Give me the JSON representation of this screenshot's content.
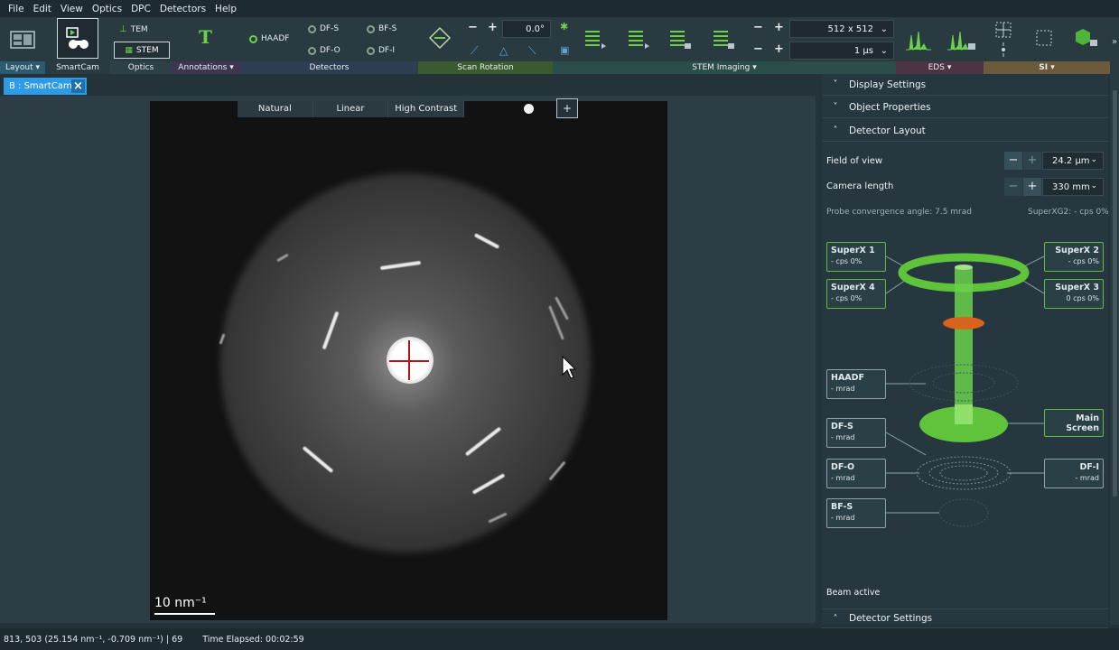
{
  "menu": [
    "File",
    "Edit",
    "View",
    "Optics",
    "DPC",
    "Detectors",
    "Help"
  ],
  "ribbon": {
    "layout_label": "Layout",
    "smartcam_label": "SmartCam",
    "optics_label": "Optics",
    "tem_label": "TEM",
    "stem_label": "STEM",
    "annotations_label": "Annotations",
    "detectors_label": "Detectors",
    "haadf_label": "HAADF",
    "dfs_label": "DF-S",
    "dfo_label": "DF-O",
    "bfs_label": "BF-S",
    "dfi_label": "DF-I",
    "scan_rotation_label": "Scan Rotation",
    "scan_rotation_value": "0.0°",
    "stem_imaging_label": "STEM Imaging",
    "resolution_value": "512 x 512",
    "dwell_value": "1 µs",
    "eds_label": "EDS",
    "si_label": "SI"
  },
  "tab": {
    "label": "B : SmartCam"
  },
  "viewer": {
    "contrast_modes": [
      "Natural",
      "Linear",
      "High Contrast"
    ],
    "scalebar_label": "10 nm⁻¹"
  },
  "panel": {
    "display_settings": "Display Settings",
    "object_properties": "Object Properties",
    "detector_layout": "Detector Layout",
    "field_of_view_label": "Field of view",
    "field_of_view_value": "24.2 µm",
    "camera_length_label": "Camera length",
    "camera_length_value": "330 mm",
    "probe_convergence": "Probe convergence angle: 7.5 mrad",
    "superxg2": "SuperXG2: - cps 0%",
    "detectors": {
      "superx1": {
        "name": "SuperX 1",
        "sub": "- cps 0%"
      },
      "superx2": {
        "name": "SuperX 2",
        "sub": "- cps 0%"
      },
      "superx4": {
        "name": "SuperX 4",
        "sub": "- cps 0%"
      },
      "superx3": {
        "name": "SuperX 3",
        "sub": "0 cps 0%"
      },
      "haadf": {
        "name": "HAADF",
        "sub": "- mrad"
      },
      "dfs": {
        "name": "DF-S",
        "sub": "- mrad"
      },
      "dfo": {
        "name": "DF-O",
        "sub": "- mrad"
      },
      "dfi": {
        "name": "DF-I",
        "sub": "- mrad"
      },
      "bfs": {
        "name": "BF-S",
        "sub": "- mrad"
      },
      "main_screen": {
        "name": "Main Screen"
      }
    },
    "beam_status": "Beam active",
    "detector_settings": "Detector Settings"
  },
  "status": {
    "coords": "813, 503 (25.154 nm⁻¹, -0.709 nm⁻¹) | 69",
    "elapsed": "Time Elapsed: 00:02:59"
  },
  "colors": {
    "accent_green": "#6bd14b",
    "tab_blue": "#2f9be4",
    "crosshair_red": "#b0141a"
  }
}
